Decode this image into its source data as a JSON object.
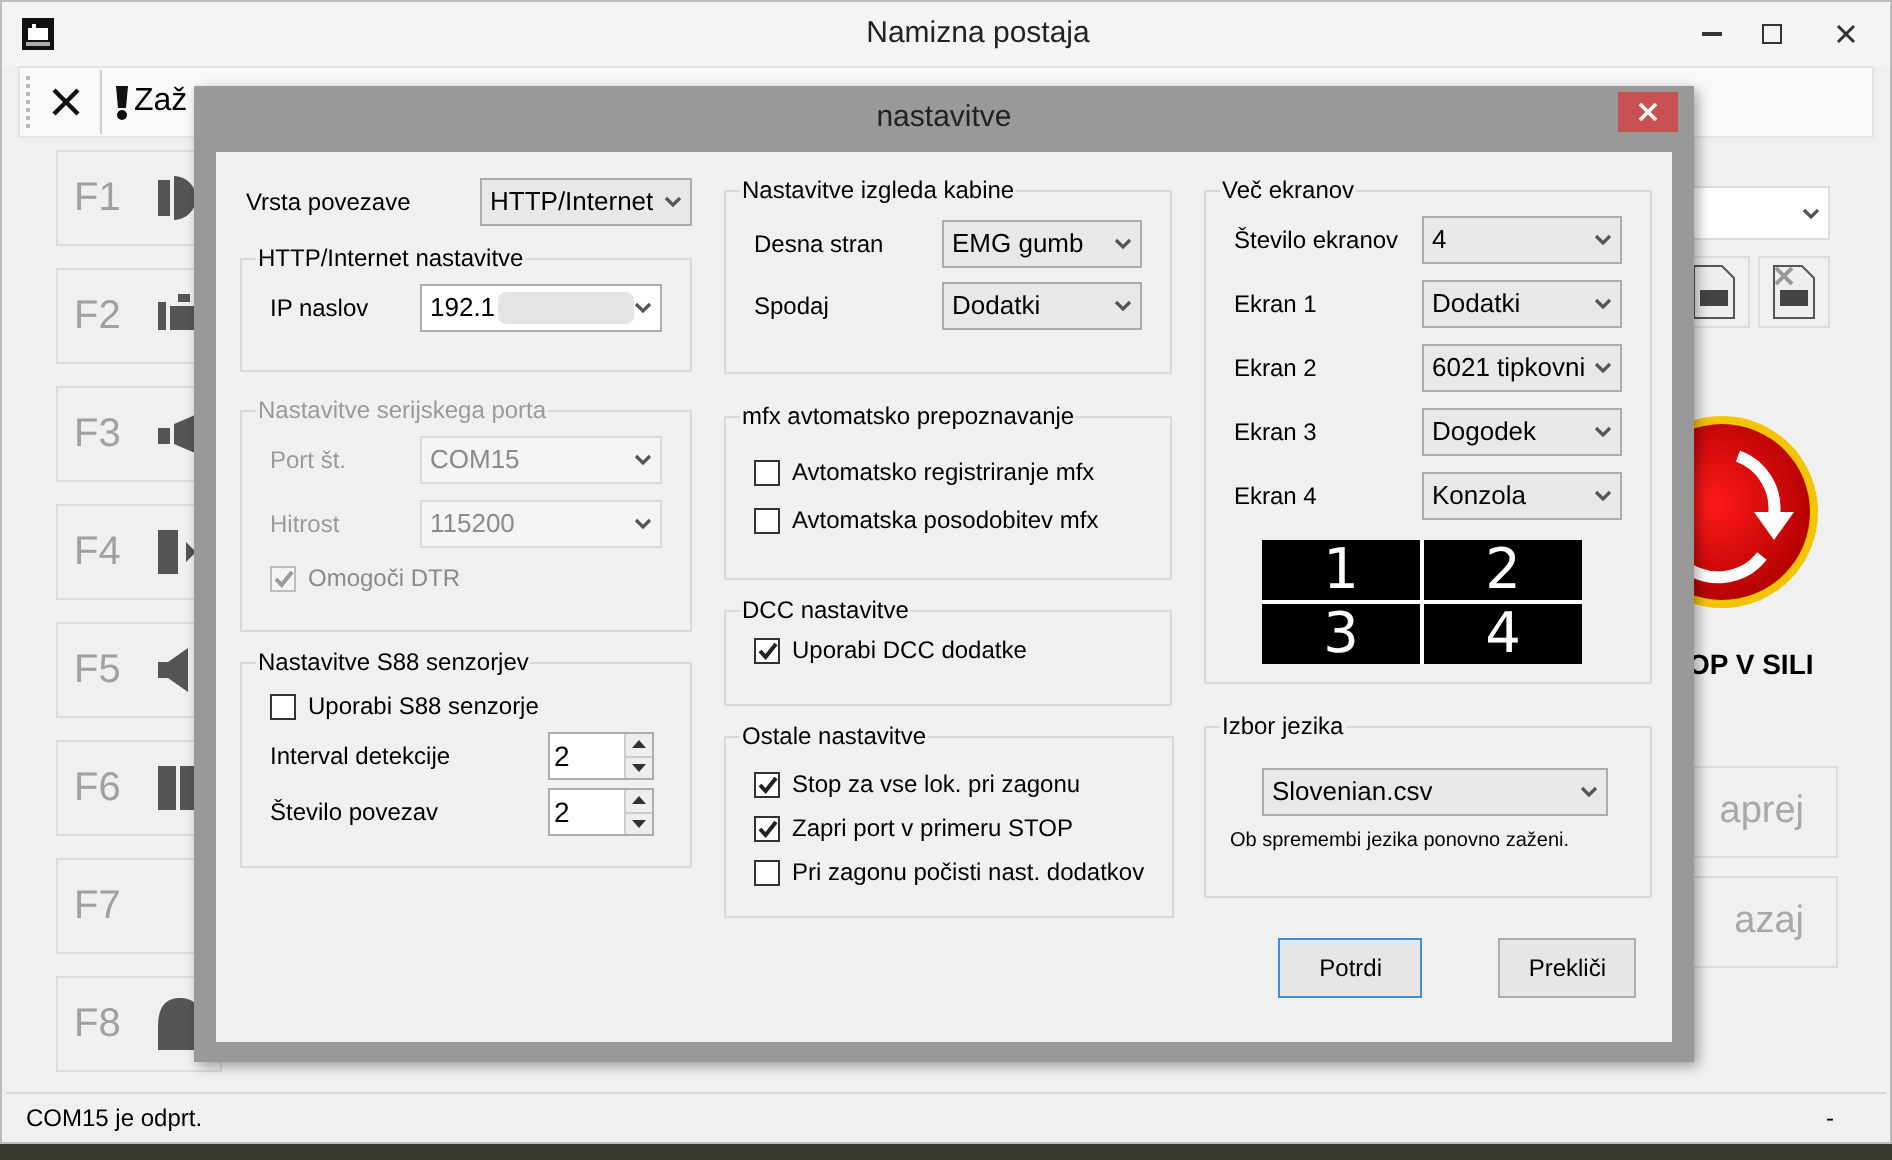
{
  "window": {
    "title": "Namizna postaja"
  },
  "toolbar": {
    "label": "Zaž"
  },
  "function_buttons": [
    {
      "label": "F1"
    },
    {
      "label": "F2"
    },
    {
      "label": "F3"
    },
    {
      "label": "F4"
    },
    {
      "label": "F5"
    },
    {
      "label": "F6"
    },
    {
      "label": "F7"
    },
    {
      "label": "F8"
    }
  ],
  "right_panel": {
    "stop_label": "OP V SILI",
    "buttons": [
      "aprej",
      "azaj"
    ]
  },
  "status_bar": {
    "left": "COM15 je odprt.",
    "right": "-"
  },
  "dialog": {
    "title": "nastavitve",
    "connection": {
      "label": "Vrsta povezave",
      "value": "HTTP/Internet"
    },
    "http_group": {
      "title": "HTTP/Internet nastavitve",
      "ip_label": "IP naslov",
      "ip_value": "192.1"
    },
    "serial_group": {
      "title": "Nastavitve serijskega porta",
      "disabled": true,
      "port_label": "Port št.",
      "port_value": "COM15",
      "speed_label": "Hitrost",
      "speed_value": "115200",
      "dtr": {
        "label": "Omogoči DTR",
        "checked": true
      }
    },
    "s88_group": {
      "title": "Nastavitve S88 senzorjev",
      "checkbox": {
        "label": "Uporabi S88 senzorje",
        "checked": false
      },
      "fields": [
        {
          "label": "Interval detekcije",
          "value": "2"
        },
        {
          "label": "Število povezav",
          "value": "2"
        }
      ]
    },
    "cab_group": {
      "title": "Nastavitve izgleda kabine",
      "fields": [
        {
          "label": "Desna stran",
          "value": "EMG gumb"
        },
        {
          "label": "Spodaj",
          "value": "Dodatki"
        }
      ]
    },
    "mfx_group": {
      "title": "mfx avtomatsko prepoznavanje",
      "checkboxes": [
        {
          "label": "Avtomatsko registriranje mfx",
          "checked": false
        },
        {
          "label": "Avtomatska posodobitev mfx",
          "checked": false
        }
      ]
    },
    "dcc_group": {
      "title": "DCC nastavitve",
      "checkboxes": [
        {
          "label": "Uporabi DCC dodatke",
          "checked": true
        }
      ]
    },
    "other_group": {
      "title": "Ostale nastavitve",
      "checkboxes": [
        {
          "label": "Stop za vse lok. pri zagonu",
          "checked": true
        },
        {
          "label": "Zapri port v primeru STOP",
          "checked": true
        },
        {
          "label": "Pri zagonu počisti nast. dodatkov",
          "checked": false
        }
      ]
    },
    "screens_group": {
      "title": "Več ekranov",
      "fields": [
        {
          "label": "Število ekranov",
          "value": "4"
        },
        {
          "label": "Ekran 1",
          "value": "Dodatki"
        },
        {
          "label": "Ekran 2",
          "value": "6021 tipkovni"
        },
        {
          "label": "Ekran 3",
          "value": "Dogodek"
        },
        {
          "label": "Ekran 4",
          "value": "Konzola"
        }
      ],
      "layout_labels": [
        "1",
        "2",
        "3",
        "4"
      ]
    },
    "language_group": {
      "title": "Izbor jezika",
      "value": "Slovenian.csv",
      "note": "Ob spremembi jezika ponovno zaženi."
    },
    "buttons": [
      {
        "label": "Potrdi",
        "focused": true
      },
      {
        "label": "Prekliči",
        "focused": false
      }
    ]
  }
}
